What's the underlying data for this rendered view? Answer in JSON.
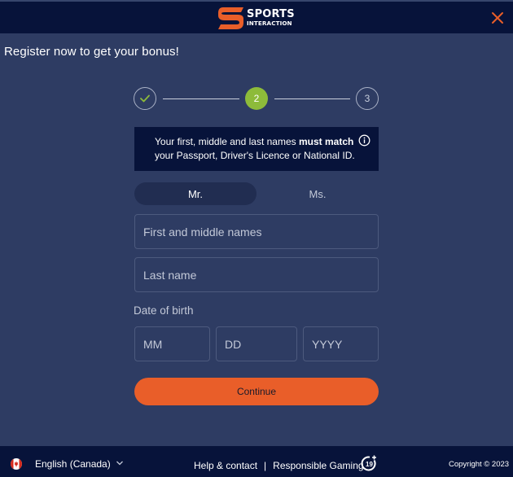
{
  "header": {
    "logo_line1": "SPORTS",
    "logo_line2": "INTERACTION",
    "close_icon": "close-icon"
  },
  "page_heading": "Register now to get your bonus!",
  "stepper": {
    "steps": [
      {
        "label": "",
        "state": "completed",
        "icon": "check-icon"
      },
      {
        "label": "2",
        "state": "active"
      },
      {
        "label": "3",
        "state": "upcoming"
      }
    ],
    "current_step": 2,
    "total_steps": 3
  },
  "info": {
    "text_before": "Your first, middle and last names ",
    "text_bold": "must match",
    "text_after": "your Passport, Driver's Licence or National ID.",
    "icon": "info-icon"
  },
  "salutation": {
    "options": [
      "Mr.",
      "Ms."
    ],
    "selected": "Mr."
  },
  "form": {
    "first_names_placeholder": "First and middle names",
    "first_names_value": "",
    "last_name_placeholder": "Last name",
    "last_name_value": "",
    "dob_label": "Date of birth",
    "dob_month_placeholder": "MM",
    "dob_day_placeholder": "DD",
    "dob_year_placeholder": "YYYY"
  },
  "continue_label": "Continue",
  "footer": {
    "language": "English (Canada)",
    "help_link": "Help & contact",
    "separator": "|",
    "responsible_link": "Responsible Gaming",
    "age_badge": "19+",
    "copyright": "Copyright © 2023"
  },
  "colors": {
    "brand_orange": "#e95e29",
    "active_step_green": "#8dbb3a",
    "header_navy": "#07133a",
    "page_bg": "#2e3c63"
  }
}
